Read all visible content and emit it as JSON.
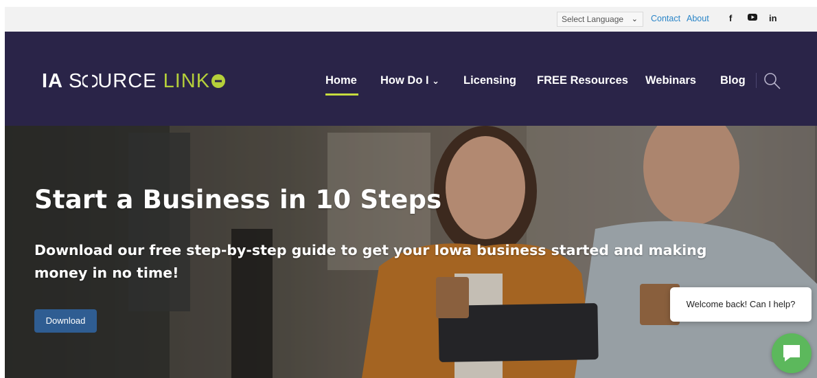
{
  "topbar": {
    "language_select": "Select Language",
    "links": [
      "Contact",
      "About"
    ],
    "social_icons": [
      "facebook-icon",
      "youtube-icon",
      "linkedin-icon"
    ],
    "social_glyphs": [
      "f",
      "▶",
      "in"
    ]
  },
  "header": {
    "logo": {
      "ia": "IA",
      "source": "SOURCE",
      "link": "LINK"
    },
    "nav": [
      {
        "label": "Home",
        "active": true
      },
      {
        "label": "How Do I",
        "has_dropdown": true
      },
      {
        "label": "Licensing"
      },
      {
        "label": "FREE Resources"
      },
      {
        "label": "Webinars"
      },
      {
        "label": "Blog"
      }
    ],
    "search_icon": "search-icon"
  },
  "hero": {
    "title": "Start a Business in 10 Steps",
    "subtitle": "Download our free step-by-step guide to get your Iowa business started and making money in no time!",
    "button_label": "Download"
  },
  "chat": {
    "greeting": "Welcome back! Can I help?",
    "icon": "chat-icon"
  },
  "colors": {
    "header_bg": "#2a2448",
    "accent": "#c7dd3e",
    "link": "#2a85c8",
    "button": "#2f5d92",
    "chat": "#5cb85c"
  }
}
